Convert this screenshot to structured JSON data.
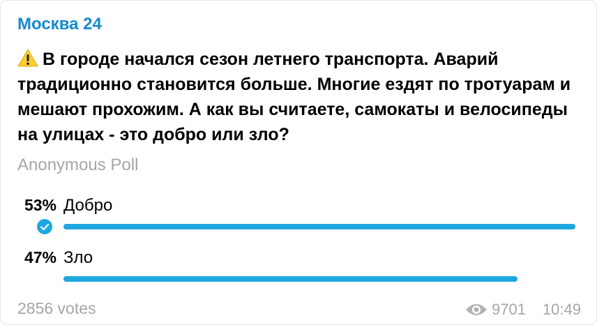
{
  "channel": {
    "name": "Москва 24"
  },
  "message": {
    "emoji": "warning-icon",
    "text": "В городе начался сезон летнего транспорта. Аварий традиционно становится больше. Многие ездят по тротуарам и мешают прохожим. А как вы считаете, самокаты и велосипеды на улицах - это добро или зло?"
  },
  "poll": {
    "type": "Anonymous Poll",
    "options": [
      {
        "percent_label": "53%",
        "label": "Добро",
        "fraction": 0.53,
        "chosen": true
      },
      {
        "percent_label": "47%",
        "label": "Зло",
        "fraction": 0.47,
        "chosen": false
      }
    ],
    "votes": "2856 votes"
  },
  "footer": {
    "views": "9701",
    "time": "10:49"
  },
  "colors": {
    "accent": "#168acd",
    "bar": "#1fa7e0",
    "muted": "#a6a6a6"
  }
}
